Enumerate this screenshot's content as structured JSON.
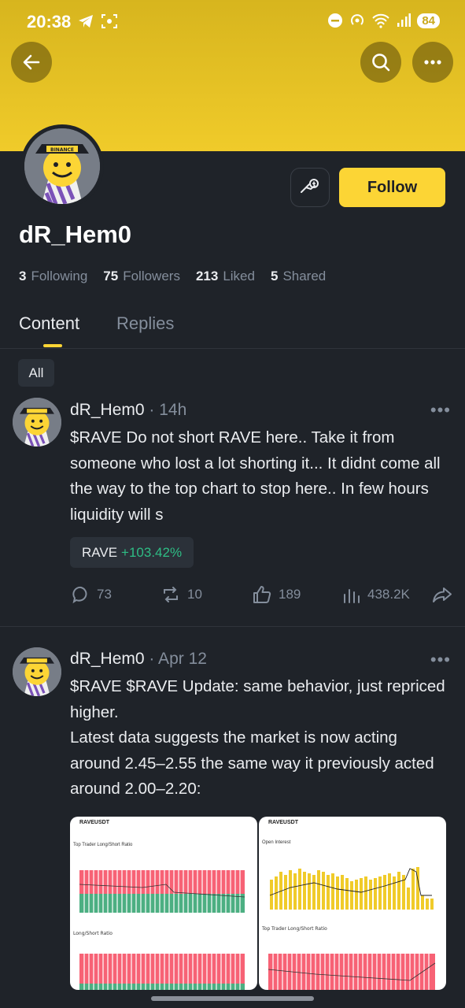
{
  "status_bar": {
    "time": "20:38",
    "battery": "84"
  },
  "nav": {
    "back_icon": "arrow-left-icon",
    "search_icon": "search-icon",
    "more_icon": "more-horizontal-icon"
  },
  "profile": {
    "username": "dR_Hem0",
    "follow_label": "Follow",
    "stats": [
      {
        "value": "3",
        "label": "Following"
      },
      {
        "value": "75",
        "label": "Followers"
      },
      {
        "value": "213",
        "label": "Liked"
      },
      {
        "value": "5",
        "label": "Shared"
      }
    ]
  },
  "tabs": [
    {
      "label": "Content",
      "active": true
    },
    {
      "label": "Replies",
      "active": false
    }
  ],
  "filter": {
    "label": "All"
  },
  "posts": [
    {
      "author": "dR_Hem0",
      "time": "· 14h",
      "body": "$RAVE Do not short RAVE here.. Take it from someone who lost a lot shorting it... It didnt come all the way to the top chart to stop here.. In few hours liquidity will s",
      "coin": {
        "symbol": "RAVE",
        "change": "+103.42%"
      },
      "actions": {
        "comments": "73",
        "reposts": "10",
        "likes": "189",
        "views": "438.2K"
      }
    },
    {
      "author": "dR_Hem0",
      "time": "· Apr 12",
      "body": "$RAVE $RAVE Update: same behavior, just repriced higher.",
      "body2": "Latest data suggests the market is now acting around 2.45–2.55 the same way it previously acted around 2.00–2.20:",
      "images": [
        {
          "title": "RAVEUSDT",
          "sub1": "Top Trader Long/Short Ratio",
          "sub2": "Long/Short Ratio"
        },
        {
          "title": "RAVEUSDT",
          "sub1": "Open Interest",
          "sub2": "Top Trader Long/Short Ratio"
        }
      ]
    }
  ],
  "colors": {
    "accent": "#fcd535",
    "up": "#2ebd85",
    "down": "#f6465d",
    "bg": "#1f2329"
  }
}
